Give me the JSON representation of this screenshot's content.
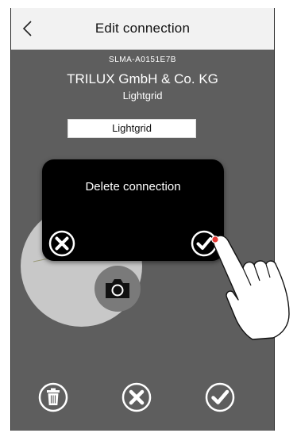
{
  "header": {
    "title": "Edit connection",
    "back_icon": "chevron-left-icon"
  },
  "device": {
    "serial": "SLMA-A0151E7B",
    "company": "TRILUX GmbH & Co. KG",
    "product": "Lightgrid"
  },
  "connection_name": {
    "value": "Lightgrid"
  },
  "dialog": {
    "title": "Delete connection",
    "cancel_icon": "close-icon",
    "confirm_icon": "checkmark-icon"
  },
  "bottom_bar": {
    "delete_icon": "trash-icon",
    "cancel_icon": "close-icon",
    "confirm_icon": "checkmark-icon"
  },
  "colors": {
    "background": "#5e5e5e",
    "header": "#f2f2f2",
    "dialog": "#000000",
    "tap_indicator": "#e53935"
  }
}
